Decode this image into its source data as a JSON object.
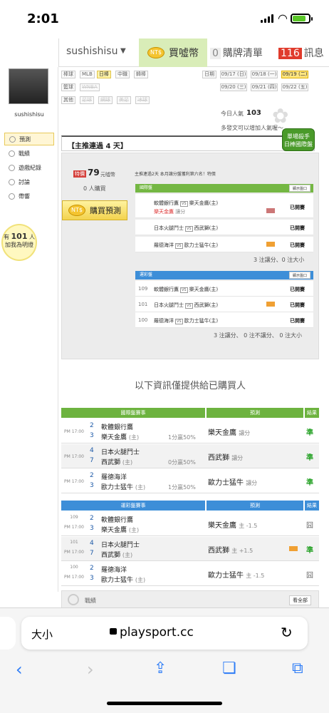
{
  "status": {
    "time": "2:01"
  },
  "topnav": {
    "username": "sushishisu",
    "buy_label": "買噓幣",
    "coin_icon_text": "NT$",
    "board_count": "0",
    "board_label": "購牌清單",
    "msg_count": "116",
    "msg_label": "訊息"
  },
  "sidebar": {
    "username": "sushishisu",
    "items": [
      {
        "label": "預測"
      },
      {
        "label": "戰績"
      },
      {
        "label": "遊戲紀錄"
      },
      {
        "label": "討論"
      },
      {
        "label": "帶響"
      }
    ],
    "bulb": {
      "prefix": "有",
      "count": "101",
      "suffix": "人",
      "line2": "加我為明燈"
    }
  },
  "filters": {
    "row1": [
      "棒球",
      "MLB",
      "日棒",
      "中職",
      "韓棒"
    ],
    "row2": [
      "籃球",
      "WNBA"
    ],
    "row3": [
      "其他",
      "足球",
      "網球",
      "美足",
      "冰球"
    ],
    "date_label": "日期",
    "dates": [
      "09/17 (日)",
      "09/18 (一)",
      "09/19 (二)",
      "09/20 (三)",
      "09/21 (四)",
      "09/22 (五)"
    ],
    "visitors_label": "今日人氣",
    "visitors": "103",
    "note": "多發文可以增加人氣喔～"
  },
  "streak": {
    "title": "【主推連過 4 天】",
    "badge": "單場殺手\n日棒國際盤",
    "price_tag": "特價",
    "price": "79",
    "price_unit": "元噓幣",
    "buyers": "0 人購買",
    "buy_button": "購買預測",
    "info": "主推連過2天 本月讓分盤獲利第六名！特價"
  },
  "intl": {
    "header": "國際盤",
    "show": "顯示盤口",
    "rows": [
      {
        "home": "軟體銀行鷹",
        "vs": "VS",
        "away": "樂天金鷹(主)",
        "pick": "樂天金鷹",
        "pick_type": "讓分",
        "status": "已開賽"
      },
      {
        "home": "日本火腿鬥士",
        "vs": "VS",
        "away": "西武獅(主)",
        "status": "已開賽"
      },
      {
        "home": "羅德海洋",
        "vs": "VS",
        "away": "歐力士猛牛(主)",
        "status": "已開賽"
      }
    ],
    "summary": "3 注讓分、0 注大小"
  },
  "lottery": {
    "header": "運彩盤",
    "show": "顯示盤口",
    "rows": [
      {
        "no": "109",
        "home": "軟體銀行鷹",
        "vs": "VS",
        "away": "樂天金鷹(主)",
        "status": "已開賽"
      },
      {
        "no": "101",
        "home": "日本火腿鬥士",
        "vs": "VS",
        "away": "西武獅(主)",
        "status": "已開賽"
      },
      {
        "no": "100",
        "home": "羅德海洋",
        "vs": "VS",
        "away": "歐力士猛牛(主)",
        "status": "已開賽"
      }
    ],
    "summary": "3 注讓分、 0 注不讓分、 0 注大小"
  },
  "info_msg": "以下資訊僅提供給已購買人",
  "intl_tbl": {
    "h1": "國際盤賽事",
    "h2": "預測",
    "h3": "結果",
    "rows": [
      {
        "time": "PM 17:00",
        "s1": "2",
        "t1": "軟體銀行鷹",
        "s2": "3",
        "t2": "樂天金鷹",
        "h": "(主)",
        "line": "1分贏50%",
        "pick": "樂天金鷹",
        "pt": "讓分",
        "res": "準"
      },
      {
        "time": "PM 17:00",
        "s1": "4",
        "t1": "日本火腿鬥士",
        "s2": "7",
        "t2": "西武獅",
        "h": "(主)",
        "line": "0分贏50%",
        "pick": "西武獅",
        "pt": "讓分",
        "res": "準"
      },
      {
        "time": "PM 17:00",
        "s1": "2",
        "t1": "羅德海洋",
        "s2": "3",
        "t2": "歐力士猛牛",
        "h": "(主)",
        "line": "1分贏50%",
        "pick": "歐力士猛牛",
        "pt": "讓分",
        "res": "準"
      }
    ]
  },
  "lot_tbl": {
    "h1": "運彩盤賽事",
    "h2": "預測",
    "h3": "結果",
    "rows": [
      {
        "no": "109",
        "time": "PM 17:00",
        "s1": "2",
        "t1": "軟體銀行鷹",
        "s2": "3",
        "t2": "樂天金鷹",
        "h": "(主)",
        "pick": "樂天金鷹",
        "pt": "主 -1.5",
        "res": "囧"
      },
      {
        "no": "101",
        "time": "PM 17:00",
        "s1": "4",
        "t1": "日本火腿鬥士",
        "s2": "7",
        "t2": "西武獅",
        "h": "(主)",
        "pick": "西武獅",
        "pt": "主 +1.5",
        "res": "準"
      },
      {
        "no": "100",
        "time": "PM 17:00",
        "s1": "2",
        "t1": "羅德海洋",
        "s2": "3",
        "t2": "歐力士猛牛",
        "h": "(主)",
        "pick": "歐力士猛牛",
        "pt": "主 -1.5",
        "res": "囧"
      }
    ]
  },
  "bottom": {
    "label": "戰績",
    "see_all": "看全部"
  },
  "browser": {
    "aa": "大小",
    "url": "playsport.cc"
  }
}
